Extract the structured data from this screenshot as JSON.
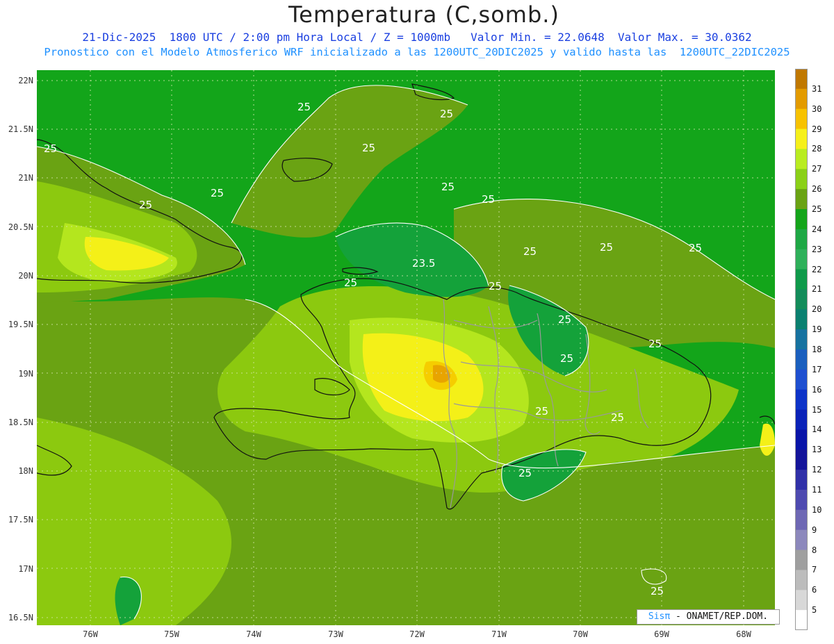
{
  "title": "Temperatura (C,somb.)",
  "subtitle_line1": "21-Dic-2025  1800 UTC / 2:00 pm Hora Local / Z = 1000mb   Valor Min. = 22.0648  Valor Max. = 30.0362",
  "subtitle_line2": "Pronostico con el Modelo Atmosferico WRF inicializado a las 1200UTC_20DIC2025 y valido hasta las  1200UTC_22DIC2025",
  "colors": {
    "ocean": "#13a51a",
    "t25": "#6aa313",
    "t26": "#8cc90f",
    "t27": "#b4e61e",
    "t28": "#f4f018",
    "t29": "#f5cd00",
    "t30": "#e8a400",
    "t23": "#14a23a",
    "border": "#111111",
    "contour": "#ffffff",
    "provinces": "#9a9a9a"
  },
  "lat_labels": [
    "22N",
    "21.5N",
    "21N",
    "20.5N",
    "20N",
    "19.5N",
    "19N",
    "18.5N",
    "18N",
    "17.5N",
    "17N",
    "16.5N"
  ],
  "lon_labels": [
    "76W",
    "75W",
    "74W",
    "73W",
    "72W",
    "71W",
    "70W",
    "69W",
    "68W"
  ],
  "contour_labels": [
    "25",
    "25",
    "25",
    "25",
    "25",
    "25",
    "25",
    "25",
    "25",
    "25",
    "23.5",
    "25",
    "25",
    "25",
    "25",
    "25",
    "25",
    "25",
    "25",
    "25",
    "25"
  ],
  "colorbar": {
    "labels": [
      "31",
      "30",
      "29",
      "28",
      "27",
      "26",
      "25",
      "24",
      "23",
      "22",
      "21",
      "20",
      "19",
      "18",
      "17",
      "16",
      "15",
      "14",
      "13",
      "12",
      "11",
      "10",
      "9",
      "8",
      "7",
      "6",
      "5"
    ],
    "colors": [
      "#c07800",
      "#e39b00",
      "#f7c200",
      "#f6f01a",
      "#b9ec20",
      "#8bd017",
      "#6aa313",
      "#14a51a",
      "#1ea845",
      "#2eb05a",
      "#0f9a4a",
      "#138c5a",
      "#0a8070",
      "#1672a0",
      "#1a5fbe",
      "#1e4fd0",
      "#0d33c8",
      "#0a22b8",
      "#0814a8",
      "#14149a",
      "#3030a8",
      "#4e4ab0",
      "#6e68b4",
      "#8c88bc",
      "#9f9f9f",
      "#bcbcbc",
      "#d8d8d8",
      "#ffffff"
    ]
  },
  "brand": {
    "sis": "Sisπ",
    "rest": " - ONAMET/REP.DOM."
  }
}
